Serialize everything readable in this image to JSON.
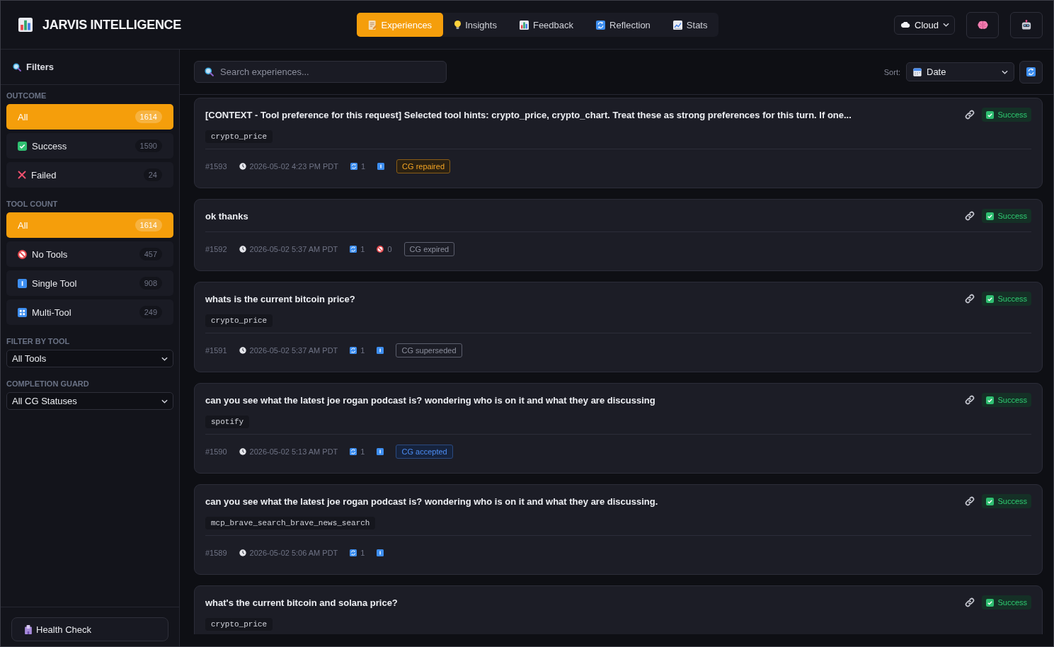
{
  "app": {
    "title": "JARVIS INTELLIGENCE"
  },
  "nav_tabs": [
    {
      "label": "Experiences",
      "selected": true
    },
    {
      "label": "Insights",
      "selected": false
    },
    {
      "label": "Feedback",
      "selected": false
    },
    {
      "label": "Reflection",
      "selected": false
    },
    {
      "label": "Stats",
      "selected": false
    }
  ],
  "environment": {
    "value": "Cloud"
  },
  "sidebar": {
    "title": "Filters",
    "sections": [
      {
        "kind": "list",
        "heading": "OUTCOME",
        "items": [
          {
            "kind": "all",
            "label": "All",
            "count": "1614",
            "selected": true
          },
          {
            "kind": "success",
            "label": "Success",
            "count": "1590",
            "selected": false
          },
          {
            "kind": "failed",
            "label": "Failed",
            "count": "24",
            "selected": false
          }
        ]
      },
      {
        "kind": "list",
        "heading": "TOOL COUNT",
        "items": [
          {
            "kind": "all",
            "label": "All",
            "count": "1614",
            "selected": true
          },
          {
            "kind": "none",
            "label": "No Tools",
            "count": "457",
            "selected": false
          },
          {
            "kind": "single",
            "label": "Single Tool",
            "count": "908",
            "selected": false
          },
          {
            "kind": "multi",
            "label": "Multi-Tool",
            "count": "249",
            "selected": false
          }
        ]
      },
      {
        "kind": "select",
        "heading": "FILTER BY TOOL",
        "value": "All Tools"
      },
      {
        "kind": "select",
        "heading": "COMPLETION GUARD",
        "value": "All CG Statuses"
      }
    ],
    "footer_button": "Health Check"
  },
  "toolbar": {
    "search": {
      "placeholder": "Search experiences..."
    },
    "sort": {
      "label": "Sort:",
      "value": "Date"
    }
  },
  "experiences": [
    {
      "title": "[CONTEXT - Tool preference for this request] Selected tool hints: crypto_price, crypto_chart. Treat these as strong preferences for this turn. If one...",
      "tool": "crypto_price",
      "outcome": {
        "kind": "success",
        "label": "Success"
      },
      "number": "#1593",
      "timestamp": "2026-05-02 4:23 PM PDT",
      "iterations": "1",
      "tool_count": {
        "kind": "single"
      },
      "cg_status": {
        "kind": "repaired",
        "label": "CG repaired"
      }
    },
    {
      "title": "ok thanks",
      "outcome": {
        "kind": "success",
        "label": "Success"
      },
      "number": "#1592",
      "timestamp": "2026-05-02 5:37 AM PDT",
      "iterations": "1",
      "tool_count": {
        "kind": "none",
        "count": "0"
      },
      "cg_status": {
        "kind": "expired",
        "label": "CG expired"
      }
    },
    {
      "title": "whats is the current bitcoin price?",
      "tool": "crypto_price",
      "outcome": {
        "kind": "success",
        "label": "Success"
      },
      "number": "#1591",
      "timestamp": "2026-05-02 5:37 AM PDT",
      "iterations": "1",
      "tool_count": {
        "kind": "single"
      },
      "cg_status": {
        "kind": "superseded",
        "label": "CG superseded"
      }
    },
    {
      "title": "can you see what the latest joe rogan podcast is? wondering who is on it and what they are discussing",
      "tool": "spotify",
      "outcome": {
        "kind": "success",
        "label": "Success"
      },
      "number": "#1590",
      "timestamp": "2026-05-02 5:13 AM PDT",
      "iterations": "1",
      "tool_count": {
        "kind": "single"
      },
      "cg_status": {
        "kind": "accepted",
        "label": "CG accepted"
      }
    },
    {
      "title": "can you see what the latest joe rogan podcast is? wondering who is on it and what they are discussing.",
      "tool": "mcp_brave_search_brave_news_search",
      "outcome": {
        "kind": "success",
        "label": "Success"
      },
      "number": "#1589",
      "timestamp": "2026-05-02 5:06 AM PDT",
      "iterations": "1",
      "tool_count": {
        "kind": "single"
      }
    },
    {
      "title": "what's the current bitcoin and solana price?",
      "tool": "crypto_price",
      "outcome": {
        "kind": "success",
        "label": "Success"
      }
    }
  ]
}
